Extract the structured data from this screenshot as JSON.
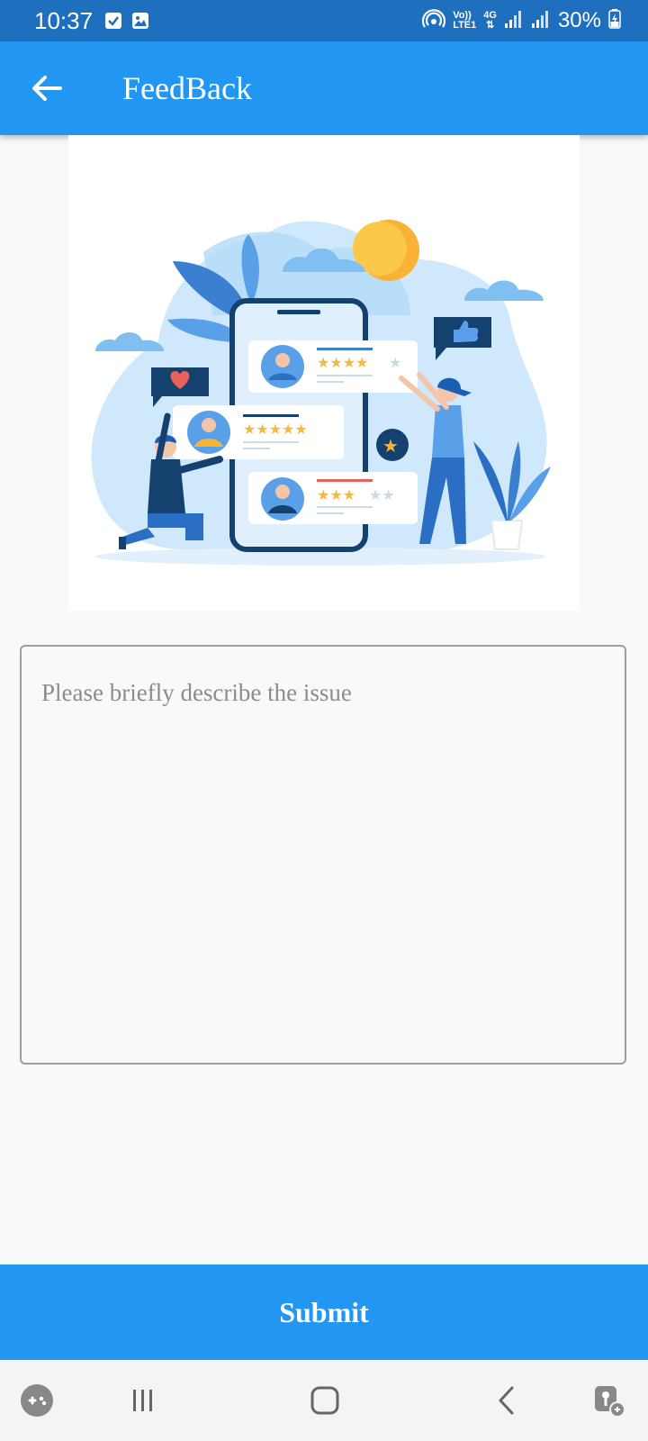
{
  "status_bar": {
    "time": "10:37",
    "battery": "30%",
    "network_top": "Vo))",
    "network_bottom": "LTE1",
    "network_type": "4G",
    "icons": [
      "checkbox-notification-icon",
      "image-notification-icon",
      "hotspot-icon",
      "signal-icon",
      "battery-charging-icon"
    ]
  },
  "app_bar": {
    "title": "FeedBack",
    "back_icon": "arrow-left-icon"
  },
  "illustration": {
    "description_icon": "feedback-review-illustration"
  },
  "feedback": {
    "placeholder": "Please briefly describe the issue",
    "value": ""
  },
  "submit": {
    "label": "Submit"
  },
  "nav_bar": {
    "icons": [
      "game-tools-icon",
      "recent-apps-icon",
      "home-icon",
      "back-icon",
      "accessibility-icon"
    ]
  },
  "colors": {
    "status_bar": "#1e6fbd",
    "primary": "#2196f3",
    "background": "#f9f9f9",
    "star": "#f5b942",
    "sun": "#f9b233"
  }
}
